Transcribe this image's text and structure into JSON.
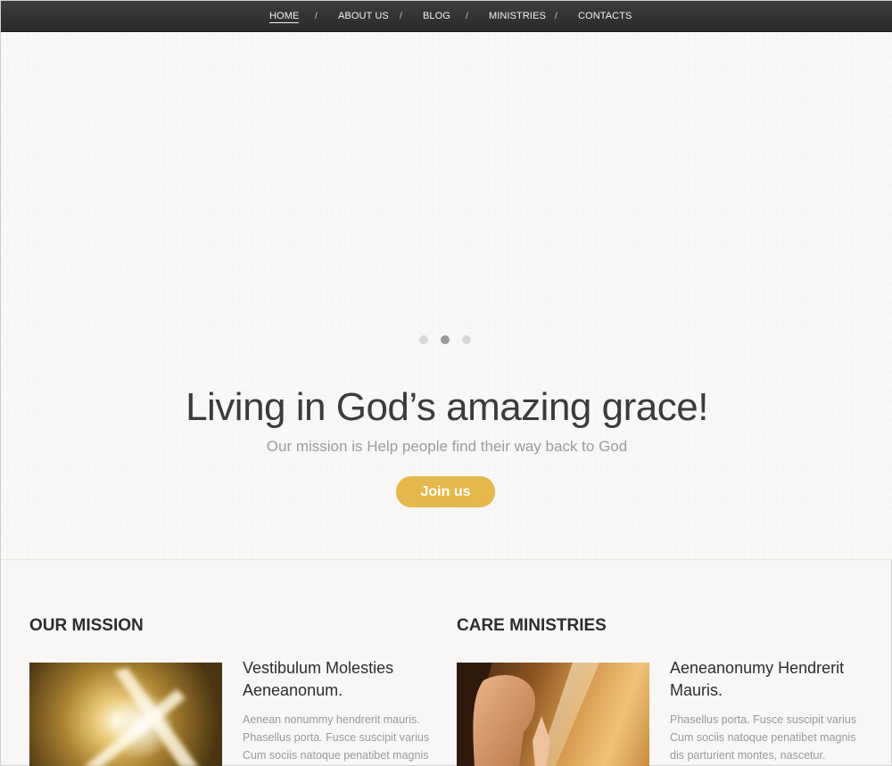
{
  "nav": {
    "items": [
      "HOME",
      "ABOUT US",
      "BLOG",
      "MINISTRIES",
      "CONTACTS"
    ],
    "separator": "/",
    "active_index": 0
  },
  "hero": {
    "slider_dots": 3,
    "active_dot": 1,
    "title": "Living in God’s amazing grace!",
    "subtitle": "Our mission is Help people find their way back to God",
    "cta_label": "Join us",
    "cta_color": "#e4b84c"
  },
  "mission": {
    "heading": "OUR MISSION",
    "image_alt": "Glowing cross",
    "item_title": "Vestibulum Molesties Aeneanonum.",
    "item_text": "Aenean nonummy hendrerit mauris. Phasellus porta.  Fusce suscipit varius Cum sociis natoque penatibet magnis"
  },
  "care": {
    "heading": "CARE MINISTRIES",
    "image_alt": "Woman praying",
    "item_title": "Aeneanonumy Hendrerit Mauris.",
    "item_text": "Phasellus porta.  Fusce suscipit varius Cum sociis natoque penatibet magnis dis parturient montes, nascetur."
  }
}
